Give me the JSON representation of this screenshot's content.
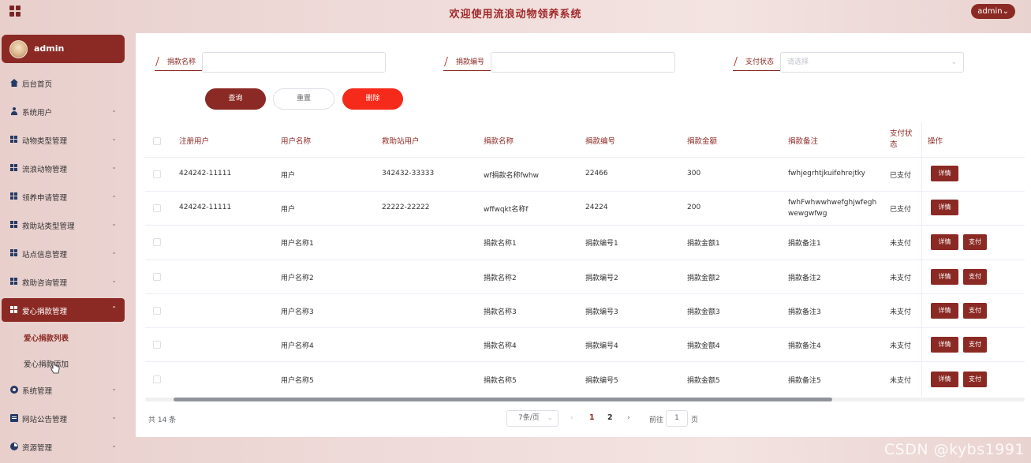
{
  "header": {
    "title": "欢迎使用流浪动物领养系统",
    "user_button": "admin"
  },
  "sidebar": {
    "user_name": "admin",
    "items": [
      {
        "label": "后台首页",
        "icon": "home-icon"
      },
      {
        "label": "系统用户",
        "icon": "user-icon"
      },
      {
        "label": "动物类型管理",
        "icon": "grid-icon"
      },
      {
        "label": "流浪动物管理",
        "icon": "grid-icon"
      },
      {
        "label": "领养申请管理",
        "icon": "grid-icon"
      },
      {
        "label": "救助站类型管理",
        "icon": "grid-icon"
      },
      {
        "label": "站点信息管理",
        "icon": "grid-icon"
      },
      {
        "label": "救助咨询管理",
        "icon": "grid-icon"
      },
      {
        "label": "爱心捐款管理",
        "icon": "grid-icon"
      },
      {
        "label": "系统管理",
        "icon": "gear-icon"
      },
      {
        "label": "网站公告管理",
        "icon": "doc-icon"
      },
      {
        "label": "资源管理",
        "icon": "pie-icon"
      }
    ],
    "sub_items": [
      "爱心捐款列表",
      "爱心捐款添加"
    ]
  },
  "filters": {
    "donation_name_label": "捐款名称",
    "donation_no_label": "捐款编号",
    "pay_status_label": "支付状态",
    "pay_status_placeholder": "请选择"
  },
  "buttons": {
    "query": "查询",
    "reset": "重置",
    "delete": "删除"
  },
  "table": {
    "headers": [
      "注册用户",
      "用户名称",
      "救助站用户",
      "捐款名称",
      "捐款编号",
      "捐款金额",
      "捐款备注",
      "支付状态",
      "操作"
    ],
    "rows": [
      {
        "reg_user": "424242-11111",
        "user_name": "用户",
        "station_user": "342432-33333",
        "donation_name": "wf捐款名称fwhw",
        "donation_no": "22466",
        "amount": "300",
        "remark": "fwhjegrhtjkuifehrejtky",
        "status": "已支付"
      },
      {
        "reg_user": "424242-11111",
        "user_name": "用户",
        "station_user": "22222-22222",
        "donation_name": "wffwqkt名称f",
        "donation_no": "24224",
        "amount": "200",
        "remark": "fwhFwhwwhwefghjwfeghwewgwfwg",
        "status": "已支付"
      },
      {
        "reg_user": "",
        "user_name": "用户名称1",
        "station_user": "",
        "donation_name": "捐款名称1",
        "donation_no": "捐款编号1",
        "amount": "捐款金额1",
        "remark": "捐款备注1",
        "status": "未支付"
      },
      {
        "reg_user": "",
        "user_name": "用户名称2",
        "station_user": "",
        "donation_name": "捐款名称2",
        "donation_no": "捐款编号2",
        "amount": "捐款金额2",
        "remark": "捐款备注2",
        "status": "未支付"
      },
      {
        "reg_user": "",
        "user_name": "用户名称3",
        "station_user": "",
        "donation_name": "捐款名称3",
        "donation_no": "捐款编号3",
        "amount": "捐款金额3",
        "remark": "捐款备注3",
        "status": "未支付"
      },
      {
        "reg_user": "",
        "user_name": "用户名称4",
        "station_user": "",
        "donation_name": "捐款名称4",
        "donation_no": "捐款编号4",
        "amount": "捐款金额4",
        "remark": "捐款备注4",
        "status": "未支付"
      },
      {
        "reg_user": "",
        "user_name": "用户名称5",
        "station_user": "",
        "donation_name": "捐款名称5",
        "donation_no": "捐款编号5",
        "amount": "捐款金额5",
        "remark": "捐款备注5",
        "status": "未支付"
      }
    ],
    "detail_label": "详情",
    "pay_label": "支付"
  },
  "pagination": {
    "total": "共 14 条",
    "page_size": "7条/页",
    "pages": [
      "1",
      "2"
    ],
    "goto_label": "前往",
    "goto_value": "1",
    "page_suffix": "页"
  },
  "watermark": "CSDN @kybs1991",
  "colors": {
    "brand": "#8b2a24",
    "danger": "#f52a1a",
    "icon": "#243a66"
  }
}
